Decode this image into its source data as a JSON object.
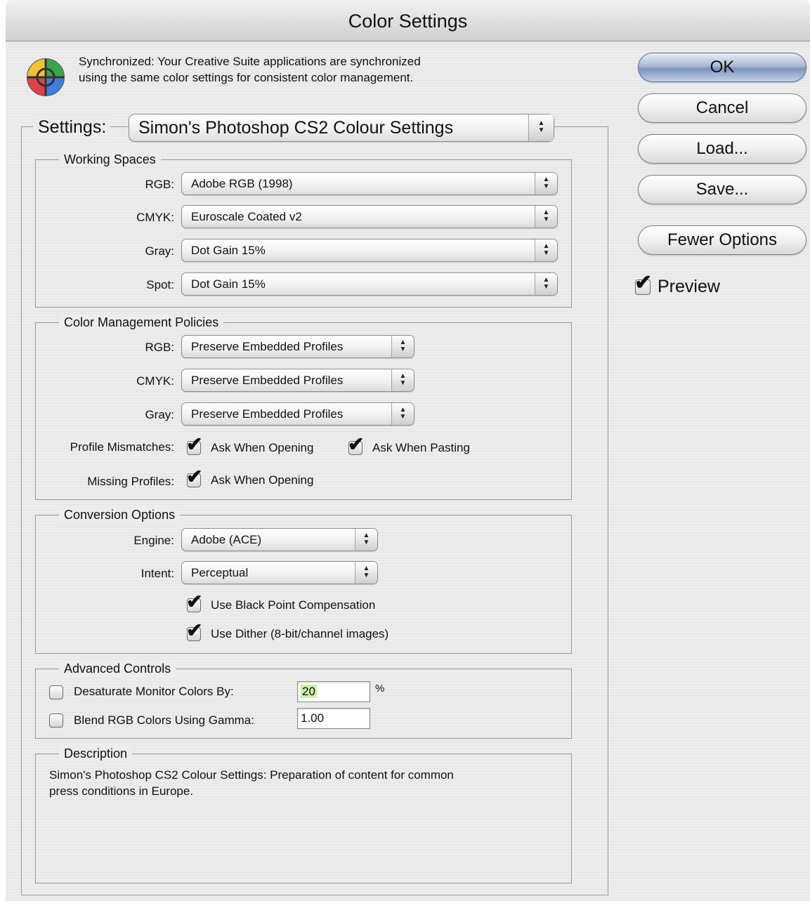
{
  "window": {
    "title": "Color Settings"
  },
  "sync": {
    "icon": "color-wheel-icon",
    "line1": "Synchronized: Your Creative Suite applications are synchronized",
    "line2": "using the same color settings for consistent color management."
  },
  "settings": {
    "label": "Settings:",
    "value": "Simon's Photoshop CS2 Colour Settings"
  },
  "working_spaces": {
    "legend": "Working Spaces",
    "rgb": {
      "label": "RGB:",
      "value": "Adobe RGB (1998)"
    },
    "cmyk": {
      "label": "CMYK:",
      "value": "Euroscale Coated v2"
    },
    "gray": {
      "label": "Gray:",
      "value": "Dot Gain 15%"
    },
    "spot": {
      "label": "Spot:",
      "value": "Dot Gain 15%"
    }
  },
  "policies": {
    "legend": "Color Management Policies",
    "rgb": {
      "label": "RGB:",
      "value": "Preserve Embedded Profiles"
    },
    "cmyk": {
      "label": "CMYK:",
      "value": "Preserve Embedded Profiles"
    },
    "gray": {
      "label": "Gray:",
      "value": "Preserve Embedded Profiles"
    },
    "mismatch_label": "Profile Mismatches:",
    "ask_opening": {
      "label": "Ask When Opening",
      "checked": true
    },
    "ask_pasting": {
      "label": "Ask When Pasting",
      "checked": true
    },
    "missing_label": "Missing Profiles:",
    "missing_ask_opening": {
      "label": "Ask When Opening",
      "checked": true
    }
  },
  "conversion": {
    "legend": "Conversion Options",
    "engine": {
      "label": "Engine:",
      "value": "Adobe (ACE)"
    },
    "intent": {
      "label": "Intent:",
      "value": "Perceptual"
    },
    "black_point": {
      "label": "Use Black Point Compensation",
      "checked": true
    },
    "dither": {
      "label": "Use Dither (8-bit/channel images)",
      "checked": true
    }
  },
  "advanced": {
    "legend": "Advanced Controls",
    "desaturate": {
      "label": "Desaturate Monitor Colors By:",
      "checked": false,
      "value": "20",
      "unit": "%"
    },
    "blend": {
      "label": "Blend RGB Colors Using Gamma:",
      "checked": false,
      "value": "1.00"
    }
  },
  "description": {
    "legend": "Description",
    "line1": "Simon's Photoshop CS2 Colour Settings:  Preparation of content for common",
    "line2": "press conditions in Europe."
  },
  "buttons": {
    "ok": "OK",
    "cancel": "Cancel",
    "load": "Load...",
    "save": "Save...",
    "fewer": "Fewer Options"
  },
  "preview": {
    "label": "Preview",
    "checked": true
  },
  "icons": {
    "check": "✔",
    "arrow_up": "▲",
    "arrow_down": "▼"
  }
}
